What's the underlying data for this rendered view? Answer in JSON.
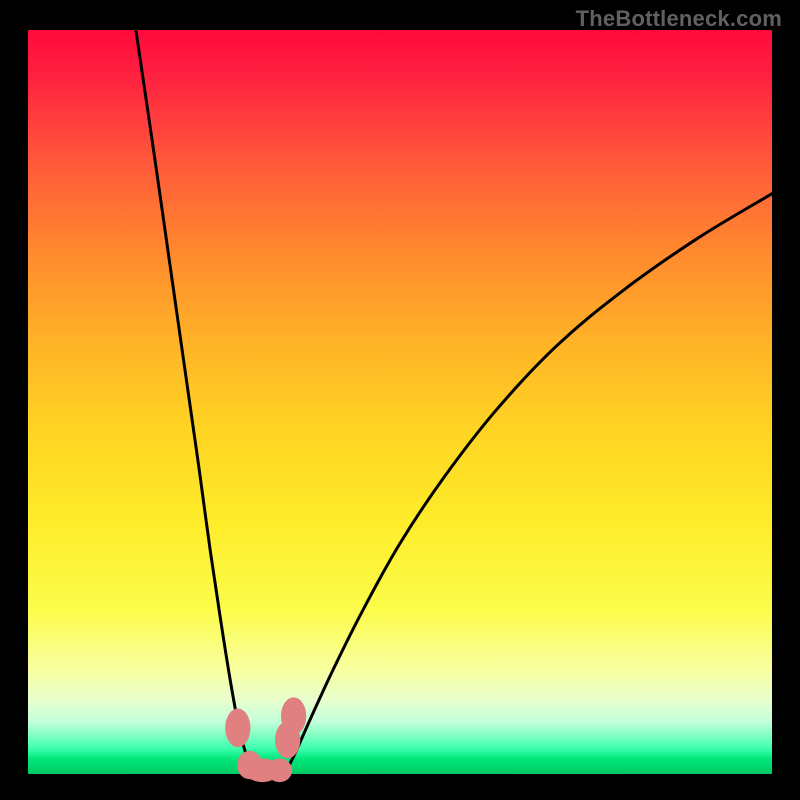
{
  "watermark": "TheBottleneck.com",
  "chart_data": {
    "type": "line",
    "title": "",
    "xlabel": "",
    "ylabel": "",
    "xlim": [
      0,
      100
    ],
    "ylim": [
      0,
      100
    ],
    "series": [
      {
        "name": "left-curve",
        "x": [
          14.5,
          17,
          19,
          21,
          23,
          24.5,
          26,
          27.2,
          28.3,
          29.2,
          30,
          31
        ],
        "values": [
          100,
          83,
          69,
          55,
          41,
          30,
          20,
          12.5,
          6.5,
          3,
          1,
          0
        ]
      },
      {
        "name": "right-curve",
        "x": [
          34.5,
          36,
          38,
          41,
          45,
          50,
          56,
          63,
          71,
          80,
          90,
          100
        ],
        "values": [
          0,
          3,
          7.5,
          14,
          22,
          31,
          40,
          49,
          57.5,
          65,
          72,
          78
        ]
      }
    ],
    "markers": [
      {
        "x": 28.2,
        "y": 6.2,
        "rx": 1.7,
        "ry": 2.6
      },
      {
        "x": 29.8,
        "y": 1.2,
        "rx": 1.7,
        "ry": 1.9
      },
      {
        "x": 31.5,
        "y": 0.5,
        "rx": 2.3,
        "ry": 1.6
      },
      {
        "x": 33.8,
        "y": 0.5,
        "rx": 1.7,
        "ry": 1.6
      },
      {
        "x": 34.9,
        "y": 4.6,
        "rx": 1.7,
        "ry": 2.5
      },
      {
        "x": 35.7,
        "y": 7.8,
        "rx": 1.7,
        "ry": 2.5
      }
    ],
    "gradient_stops": [
      {
        "pos": 0,
        "color": "#ff0a3a"
      },
      {
        "pos": 18,
        "color": "#ff5a3a"
      },
      {
        "pos": 42,
        "color": "#ffb327"
      },
      {
        "pos": 66,
        "color": "#feec2a"
      },
      {
        "pos": 90,
        "color": "#e8ffcc"
      },
      {
        "pos": 100,
        "color": "#00c862"
      }
    ]
  }
}
